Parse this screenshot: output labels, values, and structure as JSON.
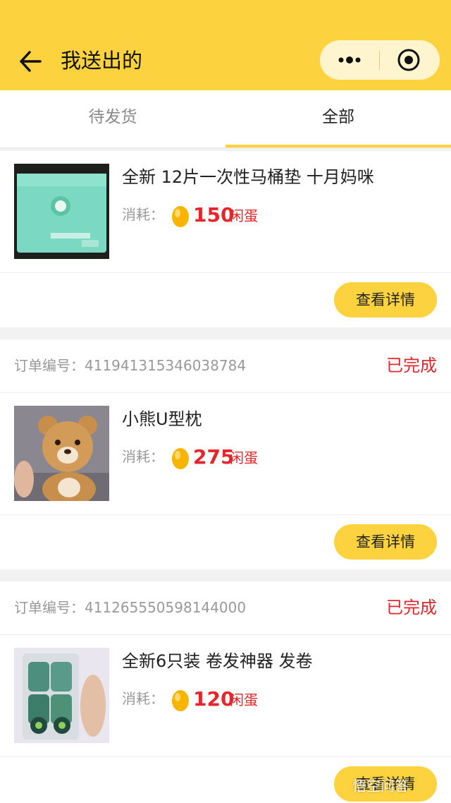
{
  "navbar": {
    "title": "我送出的",
    "back_icon": "arrow-left-icon",
    "more_icon": "more-dots-icon",
    "target_icon": "target-circle-icon",
    "bg_color": "#fcd33f"
  },
  "tabs": [
    {
      "label": "待发货",
      "active": false
    },
    {
      "label": "全部",
      "active": true
    }
  ],
  "orders": [
    {
      "order_no_label": "",
      "order_no": "",
      "status": "",
      "title": "全新 12片一次性马桶垫 十月妈咪",
      "cost_label": "消耗：",
      "cost": "150",
      "unit": "闲蛋",
      "button": "查看详情",
      "image": "toilet-seat-cover-package"
    },
    {
      "order_no_label": "订单编号：",
      "order_no": "411941315346038784",
      "status": "已完成",
      "title": "小熊U型枕",
      "cost_label": "消耗：",
      "cost": "275",
      "unit": "闲蛋",
      "button": "查看详情",
      "image": "bear-plush-pillow"
    },
    {
      "order_no_label": "订单编号：",
      "order_no": "411265550598144000",
      "status": "已完成",
      "title": "全新6只装 卷发神器 发卷",
      "cost_label": "消耗：",
      "cost": "120",
      "unit": "闲蛋",
      "button": "查看详情",
      "image": "hair-rollers-bag"
    }
  ],
  "watermark": "悟空问答",
  "colors": {
    "accent": "#fcd33f",
    "status_red": "#e5262b"
  }
}
